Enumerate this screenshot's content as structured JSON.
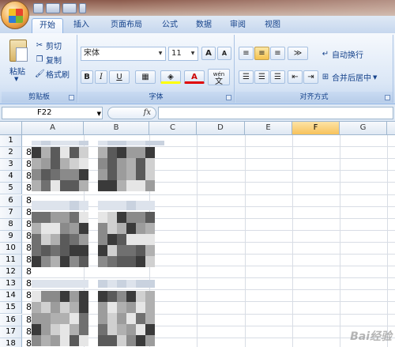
{
  "tabs": [
    {
      "label": "开始",
      "active": true
    },
    {
      "label": "插入"
    },
    {
      "label": "页面布局"
    },
    {
      "label": "公式"
    },
    {
      "label": "数据"
    },
    {
      "label": "审阅"
    },
    {
      "label": "视图"
    }
  ],
  "clipboard": {
    "group_label": "剪贴板",
    "paste": "粘贴",
    "cut": "剪切",
    "copy": "复制",
    "format_painter": "格式刷"
  },
  "font": {
    "group_label": "字体",
    "family": "宋体",
    "size": "11",
    "bold": "B",
    "italic": "I",
    "underline": "U",
    "grow": "A",
    "shrink": "A",
    "font_color": "A",
    "phonetic_top": "wén",
    "phonetic_bottom": "文"
  },
  "alignment": {
    "group_label": "对齐方式",
    "wrap_text": "自动换行",
    "merge_center": "合并后居中"
  },
  "formula_bar": {
    "name_box": "F22",
    "fx": "fx"
  },
  "grid": {
    "columns": [
      "A",
      "B",
      "C",
      "D",
      "E",
      "F",
      "G"
    ],
    "selected_column": "F",
    "rows": [
      "1",
      "2",
      "3",
      "4",
      "5",
      "6",
      "7",
      "8",
      "9",
      "10",
      "11",
      "12",
      "13",
      "14",
      "15",
      "16",
      "17",
      "18"
    ],
    "column_a_value": "8"
  },
  "watermark": "Bai经验",
  "colors": {
    "ribbon_text": "#15428b",
    "selected_header": "#f7c25b",
    "grid_line": "#d8dde5"
  }
}
